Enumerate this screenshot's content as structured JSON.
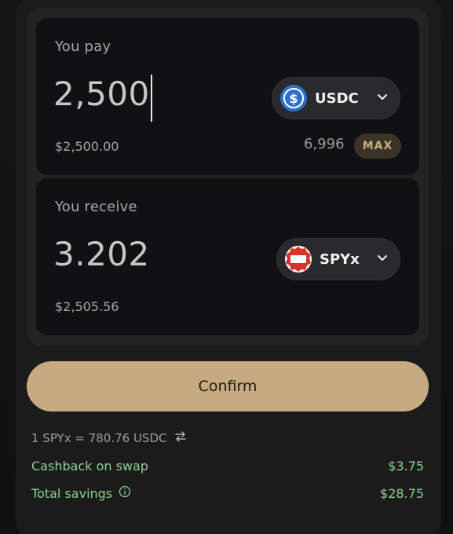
{
  "pay": {
    "label": "You pay",
    "amount": "2,500",
    "fiat_value": "$2,500.00",
    "token": "USDC",
    "balance": "6,996",
    "max_label": "MAX"
  },
  "receive": {
    "label": "You receive",
    "amount": "3.202",
    "fiat_value": "$2,505.56",
    "token": "SPYx"
  },
  "confirm_label": "Confirm",
  "rate": "1 SPYx = 780.76 USDC",
  "cashback": {
    "label": "Cashback on swap",
    "value": "$3.75"
  },
  "savings": {
    "label": "Total savings",
    "value": "$28.75"
  },
  "colors": {
    "accent": "#c8aa80",
    "positive": "#8bd18f",
    "usdc": "#2f6fc9",
    "spy": "#d9312b"
  },
  "icons": [
    "usdc-token-icon",
    "spyx-token-icon",
    "chevron-down-icon",
    "swap-arrows-icon",
    "info-icon"
  ]
}
